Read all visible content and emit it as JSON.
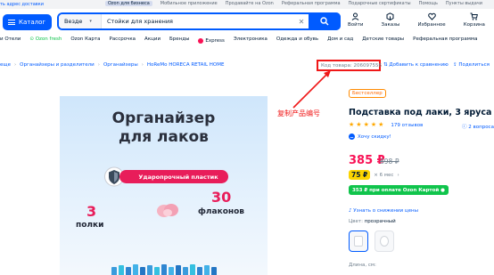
{
  "topbar": {
    "address": "ть адрес доставки",
    "links": [
      "Ozon для бизнеса",
      "Мобильное приложение",
      "Продавайте на Ozon",
      "Реферальная программа",
      "Подарочные сертификаты",
      "Помощь",
      "Пункты выдачи"
    ],
    "highlight_index": 0
  },
  "header": {
    "catalog_label": "Каталог",
    "search_scope": "Везде",
    "search_value": "Стойки для хранения",
    "actions": [
      {
        "icon": "user-icon",
        "label": "Войти"
      },
      {
        "icon": "package-icon",
        "label": "Заказы"
      },
      {
        "icon": "heart-icon",
        "label": "Избранное"
      },
      {
        "icon": "cart-icon",
        "label": "Корзина"
      }
    ]
  },
  "category_nav": [
    "и Отели",
    "Ozon fresh",
    "Ozon Карта",
    "Рассрочка",
    "Акции",
    "Бренды",
    "Express",
    "Электроника",
    "Одежда и обувь",
    "Дом и сад",
    "Детские товары",
    "Реферальная программа"
  ],
  "breadcrumbs": [
    "еще",
    "Органайзеры и разделители",
    "Органайзеры",
    "HoReMo HORECA RETAIL HOME"
  ],
  "sku": "Код товара: 206097556",
  "compare_label": "Добавить к сравнению",
  "share_label": "Поделиться",
  "annotation": "复制产品编号",
  "product_image": {
    "title_line1": "Органайзер",
    "title_line2": "для лаков",
    "badge": "Ударопрочный пластик",
    "shelves_num": "3",
    "shelves_label": "полки",
    "bottles_num": "30",
    "bottles_label": "флаконов"
  },
  "product": {
    "tag": "Бестселлер",
    "title": "Подставка под лаки, 3 яруса",
    "rating_stars": 5,
    "reviews": "179 отзывов",
    "questions": "2 вопроса",
    "wish": "Хочу скидку!",
    "price": "385 ₽",
    "old_price": "898 ₽",
    "installment_price": "75 ₽",
    "installment_terms": "× 6 мес",
    "card_price": "353 ₽ при оплате Ozon Картой",
    "notify": "Узнать о снижении цены",
    "color_label": "Цвет:",
    "color_value": "прозрачный",
    "length_label": "Длина, см:"
  },
  "colors": {
    "accent": "#005bff",
    "price": "#f91155",
    "green": "#10c44c",
    "annotation": "#f01818"
  }
}
